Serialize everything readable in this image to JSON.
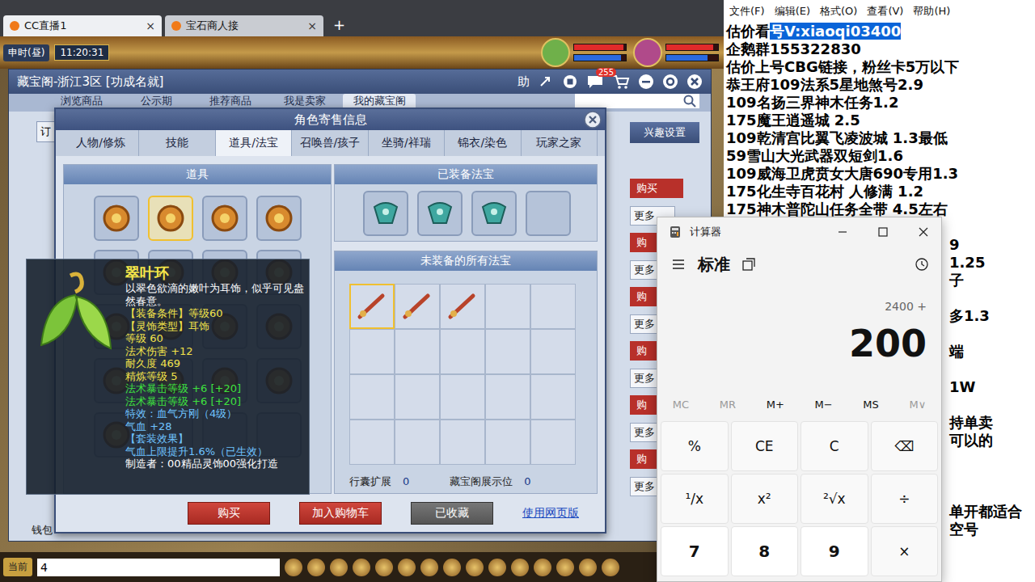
{
  "browser_tabs": [
    {
      "label": "CC直播1",
      "close": "×",
      "selected": true
    },
    {
      "label": "宝石商人接",
      "close": "×",
      "selected": false
    }
  ],
  "new_tab": "+",
  "game_clock": {
    "period": "申时(昼)",
    "time": "11:20:31"
  },
  "portraits": [
    {
      "hp": 0.95,
      "mp": 0.9
    },
    {
      "hp": 0.9,
      "mp": 0.8
    }
  ],
  "cbg_window": {
    "title": "藏宝阁-浙江3区 [功成名就]",
    "help": "助",
    "message_badge": "255",
    "tabs": [
      {
        "label": "浏览商品",
        "selected": false
      },
      {
        "label": "公示期",
        "selected": false
      },
      {
        "label": "推荐商品",
        "selected": false
      },
      {
        "label": "我是卖家",
        "selected": false
      },
      {
        "label": "我的藏宝阁",
        "selected": true
      }
    ],
    "side_button": "订",
    "interest_button": "兴趣设置",
    "rows": [
      {
        "buy": "购买",
        "more": "更多"
      },
      {
        "buy": "购",
        "more": "更多"
      },
      {
        "buy": "购",
        "more": "更多"
      },
      {
        "buy": "购",
        "more": "更多"
      },
      {
        "buy": "购",
        "more": "更多"
      },
      {
        "buy": "购",
        "more": "更多"
      }
    ],
    "wallet": "钱包"
  },
  "modal": {
    "title": "角色寄售信息",
    "tabs": [
      {
        "label": "人物/修炼",
        "selected": false
      },
      {
        "label": "技能",
        "selected": false
      },
      {
        "label": "道具/法宝",
        "selected": true
      },
      {
        "label": "召唤兽/孩子",
        "selected": false
      },
      {
        "label": "坐骑/祥瑞",
        "selected": false
      },
      {
        "label": "锦衣/染色",
        "selected": false
      },
      {
        "label": "玩家之家",
        "selected": false
      }
    ],
    "inventory_title": "道具",
    "inventory": [
      {
        "filled": true,
        "selected": false
      },
      {
        "filled": true,
        "selected": true
      },
      {
        "filled": true,
        "selected": false
      },
      {
        "filled": true,
        "selected": false
      },
      {
        "filled": true,
        "selected": false
      },
      {
        "filled": true,
        "selected": false
      },
      {
        "filled": true,
        "selected": false
      },
      {
        "filled": true,
        "selected": false
      },
      {
        "filled": true,
        "selected": false
      },
      {
        "filled": true,
        "selected": false
      },
      {
        "filled": true,
        "selected": false
      },
      {
        "filled": true,
        "selected": false
      },
      {
        "filled": true,
        "selected": false
      },
      {
        "filled": true,
        "selected": false
      },
      {
        "filled": true,
        "selected": false
      },
      {
        "filled": true,
        "selected": false
      },
      {
        "filled": true,
        "selected": false
      },
      {
        "filled": false,
        "selected": false
      },
      {
        "filled": false,
        "selected": false
      },
      {
        "filled": false,
        "selected": false
      }
    ],
    "equipped_title": "已装备法宝",
    "equipped": [
      {
        "filled": true
      },
      {
        "filled": true
      },
      {
        "filled": true
      },
      {
        "filled": false
      }
    ],
    "unequipped_title": "未装备的所有法宝",
    "unequipped": [
      {
        "filled": true,
        "selected": true
      },
      {
        "filled": true,
        "selected": false
      },
      {
        "filled": true,
        "selected": false
      },
      {
        "filled": false,
        "selected": false
      },
      {
        "filled": false,
        "selected": false
      },
      {
        "filled": false,
        "selected": false
      },
      {
        "filled": false,
        "selected": false
      },
      {
        "filled": false,
        "selected": false
      },
      {
        "filled": false,
        "selected": false
      },
      {
        "filled": false,
        "selected": false
      },
      {
        "filled": false,
        "selected": false
      },
      {
        "filled": false,
        "selected": false
      },
      {
        "filled": false,
        "selected": false
      },
      {
        "filled": false,
        "selected": false
      },
      {
        "filled": false,
        "selected": false
      },
      {
        "filled": false,
        "selected": false
      },
      {
        "filled": false,
        "selected": false
      },
      {
        "filled": false,
        "selected": false
      },
      {
        "filled": false,
        "selected": false
      },
      {
        "filled": false,
        "selected": false
      }
    ],
    "stats": [
      {
        "label": "行囊扩展",
        "value": "0"
      },
      {
        "label": "藏宝阁展示位",
        "value": "0"
      }
    ],
    "buttons": [
      {
        "label": "购买",
        "kind": "red"
      },
      {
        "label": "加入购物车",
        "kind": "red"
      },
      {
        "label": "已收藏",
        "kind": "grey"
      },
      {
        "label": "使用网页版",
        "kind": "link"
      }
    ]
  },
  "tooltip": {
    "name": "翠叶环",
    "lines": [
      {
        "text": "以翠色欲滴的嫩叶为耳饰，似乎可见盎然春意。",
        "color": "#ffffff"
      },
      {
        "text": "【装备条件】等级60",
        "color": "#f2e24a"
      },
      {
        "text": "【灵饰类型】耳饰",
        "color": "#f2e24a"
      },
      {
        "text": "等级 60",
        "color": "#f2e24a"
      },
      {
        "text": "法术伤害 +12",
        "color": "#f2e24a"
      },
      {
        "text": "耐久度 469",
        "color": "#f2e24a"
      },
      {
        "text": "精炼等级 5",
        "color": "#f2e24a"
      },
      {
        "text": "法术暴击等级 +6 [+20]",
        "color": "#3ee03e"
      },
      {
        "text": "法术暴击等级 +6 [+20]",
        "color": "#3ee03e"
      },
      {
        "text": "特效：血气方刚（4级）",
        "color": "#6fc3ff"
      },
      {
        "text": "气血 +28",
        "color": "#6fc3ff"
      },
      {
        "text": "【套装效果】",
        "color": "#6fc3ff"
      },
      {
        "text": "气血上限提升1.6%（已生效）",
        "color": "#6fc3ff"
      },
      {
        "text": "制造者：00精品灵饰00强化打造",
        "color": "#ffffff"
      }
    ]
  },
  "notepad": {
    "menu": [
      "文件(F)",
      "编辑(E)",
      "格式(O)",
      "查看(V)",
      "帮助(H)"
    ],
    "lines": [
      {
        "text": "估价看",
        "selected_text": "号V:xiaoqi03400",
        "kind": "full"
      },
      {
        "text": "企鹅群155322830",
        "selected_text": "",
        "kind": "full"
      },
      {
        "text": "估价上号CBG链接，粉丝卡5万以下",
        "selected_text": "",
        "kind": "full"
      },
      {
        "text": "恭王府109法系5星地煞号2.9",
        "selected_text": "",
        "kind": "full"
      },
      {
        "text": "109名扬三界神木任务1.2",
        "selected_text": "",
        "kind": "full"
      },
      {
        "text": "175魔王逍遥城 2.5",
        "selected_text": "",
        "kind": "full"
      },
      {
        "text": "109乾清宫比翼飞凌波城 1.3最低",
        "selected_text": "",
        "kind": "full"
      },
      {
        "text": "59雪山大光武器双短剑1.6",
        "selected_text": "",
        "kind": "full"
      },
      {
        "text": "109威海卫虎贲女大唐690专用1.3",
        "selected_text": "",
        "kind": "full"
      },
      {
        "text": "175化生寺百花村 人修满 1.2",
        "selected_text": "",
        "kind": "full"
      },
      {
        "text": "175神木普陀山任务全带 4.5左右",
        "selected_text": "",
        "kind": "full"
      },
      {
        "text": "",
        "selected_text": "",
        "kind": "cut"
      },
      {
        "text": "9",
        "selected_text": "",
        "kind": "cut"
      },
      {
        "text": "1.25",
        "selected_text": "",
        "kind": "cut"
      },
      {
        "text": "子",
        "selected_text": "",
        "kind": "cut"
      },
      {
        "text": "",
        "selected_text": "",
        "kind": "cut"
      },
      {
        "text": "多1.3",
        "selected_text": "",
        "kind": "cut"
      },
      {
        "text": "",
        "selected_text": "",
        "kind": "cut"
      },
      {
        "text": "端",
        "selected_text": "",
        "kind": "cut"
      },
      {
        "text": "",
        "selected_text": "",
        "kind": "cut"
      },
      {
        "text": "1W",
        "selected_text": "",
        "kind": "cut"
      },
      {
        "text": "",
        "selected_text": "",
        "kind": "cut"
      },
      {
        "text": "持单卖",
        "selected_text": "",
        "kind": "cut"
      },
      {
        "text": "可以的",
        "selected_text": "",
        "kind": "cut"
      },
      {
        "text": "",
        "selected_text": "",
        "kind": "cut"
      },
      {
        "text": "",
        "selected_text": "",
        "kind": "cut"
      },
      {
        "text": "",
        "selected_text": "",
        "kind": "cut"
      },
      {
        "text": "单开都适合",
        "selected_text": "",
        "kind": "cut"
      },
      {
        "text": "空号",
        "selected_text": "",
        "kind": "cut"
      }
    ]
  },
  "calculator": {
    "title": "计算器",
    "mode": "标准",
    "expression": "2400 +",
    "result": "200",
    "memory": [
      {
        "label": "MC",
        "disabled": true
      },
      {
        "label": "MR",
        "disabled": true
      },
      {
        "label": "M+",
        "disabled": false
      },
      {
        "label": "M−",
        "disabled": false
      },
      {
        "label": "MS",
        "disabled": false
      },
      {
        "label": "M∨",
        "disabled": true
      }
    ],
    "keys": [
      {
        "label": "%",
        "kind": "op"
      },
      {
        "label": "CE",
        "kind": "op"
      },
      {
        "label": "C",
        "kind": "op"
      },
      {
        "label": "⌫",
        "kind": "op"
      },
      {
        "label": "¹/x",
        "kind": "op"
      },
      {
        "label": "x²",
        "kind": "op"
      },
      {
        "label": "²√x",
        "kind": "op"
      },
      {
        "label": "÷",
        "kind": "op"
      },
      {
        "label": "7",
        "kind": "digit"
      },
      {
        "label": "8",
        "kind": "digit"
      },
      {
        "label": "9",
        "kind": "digit"
      },
      {
        "label": "×",
        "kind": "op"
      }
    ]
  },
  "game_bar": {
    "channel": "当前",
    "input": "4"
  }
}
